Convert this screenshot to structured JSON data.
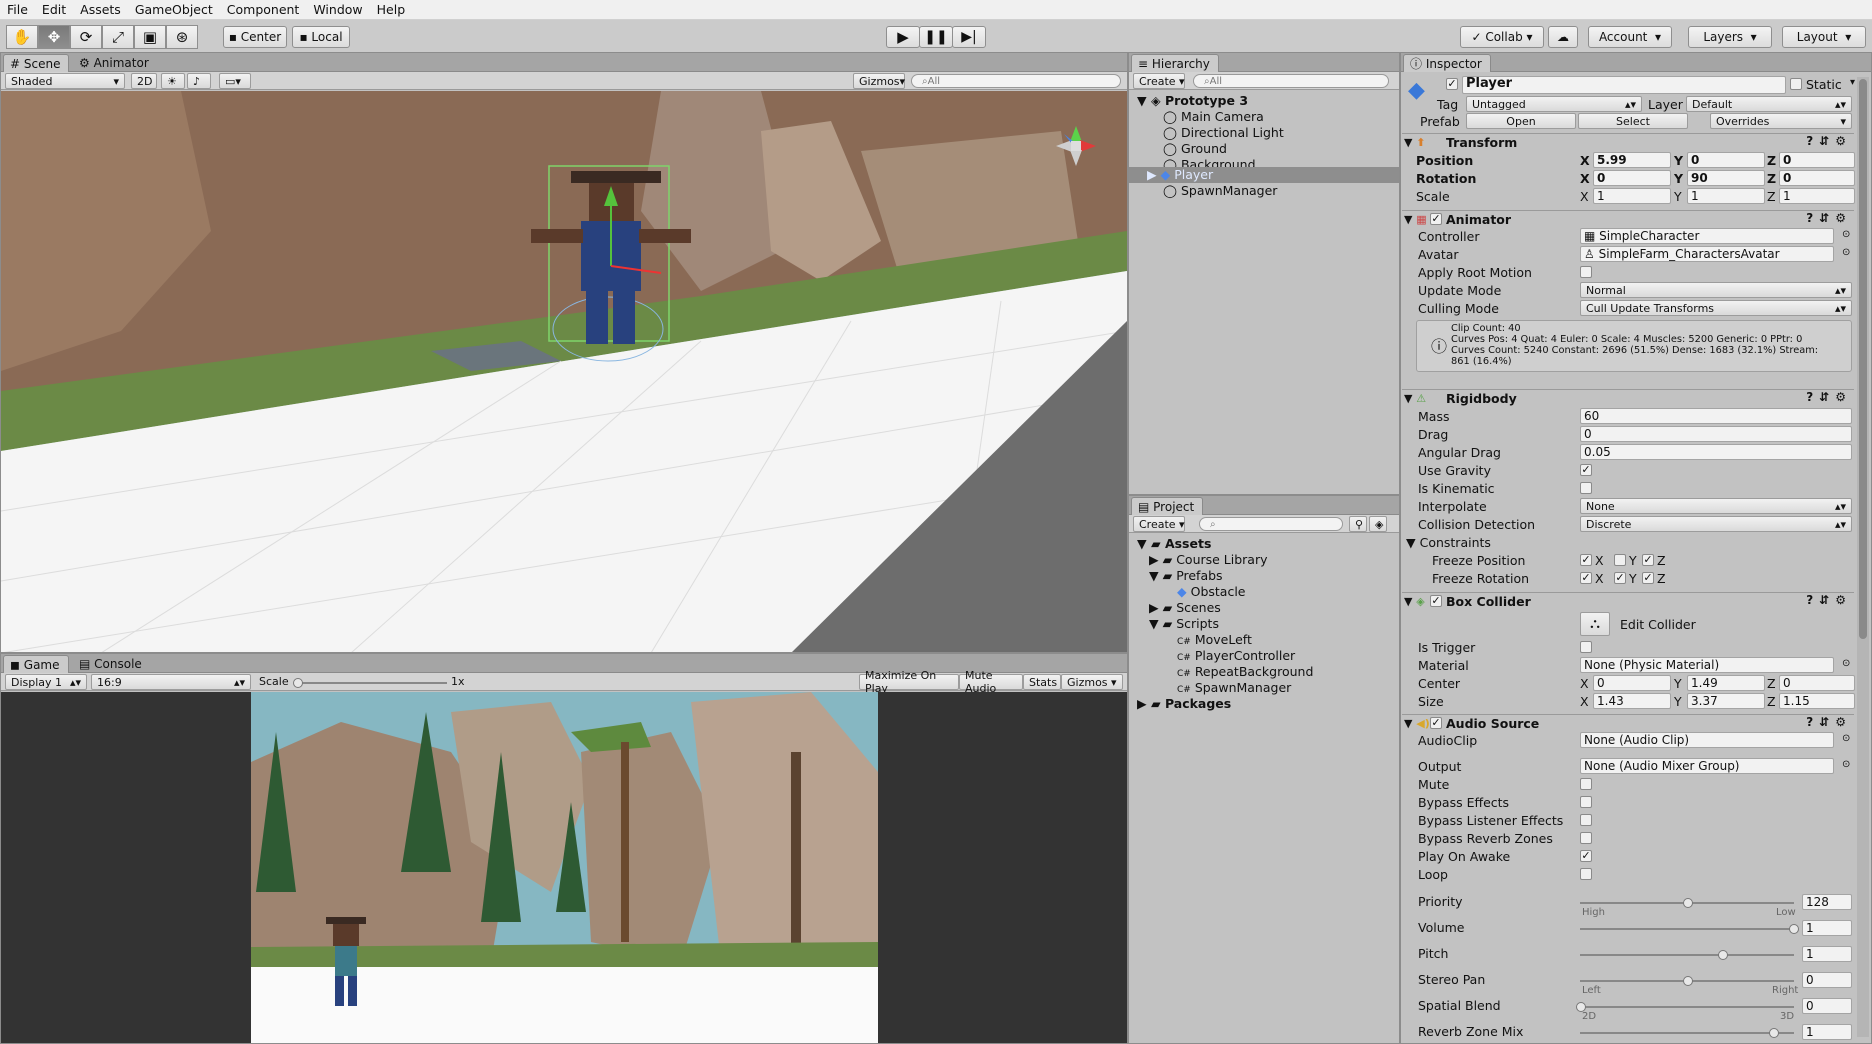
{
  "menu": [
    "File",
    "Edit",
    "Assets",
    "GameObject",
    "Component",
    "Window",
    "Help"
  ],
  "toolbar": {
    "center": "Center",
    "local": "Local",
    "collab": "Collab",
    "account": "Account",
    "layers": "Layers",
    "layout": "Layout"
  },
  "scene": {
    "tab_scene": "Scene",
    "tab_animator": "Animator",
    "shading": "Shaded",
    "mode2d": "2D",
    "gizmos": "Gizmos",
    "search": "All"
  },
  "game": {
    "tab_game": "Game",
    "tab_console": "Console",
    "display": "Display 1",
    "aspect": "16:9",
    "scale_label": "Scale",
    "scale_value": "1x",
    "maximize": "Maximize On Play",
    "mute": "Mute Audio",
    "stats": "Stats",
    "gizmos": "Gizmos"
  },
  "hierarchy": {
    "tab": "Hierarchy",
    "create": "Create",
    "search": "All",
    "scene": "Prototype 3",
    "items": [
      "Main Camera",
      "Directional Light",
      "Ground",
      "Background",
      "Player",
      "SpawnManager"
    ]
  },
  "project": {
    "tab": "Project",
    "create": "Create",
    "assets": "Assets",
    "items": [
      "Course Library",
      "Prefabs",
      "Obstacle",
      "Scenes",
      "Scripts",
      "MoveLeft",
      "PlayerController",
      "RepeatBackground",
      "SpawnManager"
    ],
    "packages": "Packages"
  },
  "inspector": {
    "tab": "Inspector",
    "name": "Player",
    "static": "Static",
    "tag_label": "Tag",
    "tag": "Untagged",
    "layer_label": "Layer",
    "layer": "Default",
    "prefab_label": "Prefab",
    "open": "Open",
    "select": "Select",
    "overrides": "Overrides",
    "transform": {
      "title": "Transform",
      "position": "Position",
      "rotation": "Rotation",
      "scale": "Scale",
      "pos": [
        "5.99",
        "0",
        "0"
      ],
      "rot": [
        "0",
        "90",
        "0"
      ],
      "scl": [
        "1",
        "1",
        "1"
      ]
    },
    "animator": {
      "title": "Animator",
      "controller_label": "Controller",
      "controller": "SimpleCharacter",
      "avatar_label": "Avatar",
      "avatar": "SimpleFarm_CharactersAvatar",
      "apply_root": "Apply Root Motion",
      "update_label": "Update Mode",
      "update": "Normal",
      "culling_label": "Culling Mode",
      "culling": "Cull Update Transforms",
      "info": [
        "Clip Count: 40",
        "Curves Pos: 4 Quat: 4 Euler: 0 Scale: 4 Muscles: 5200 Generic: 0 PPtr: 0",
        "Curves Count: 5240 Constant: 2696 (51.5%) Dense: 1683 (32.1%) Stream:",
        "861 (16.4%)"
      ]
    },
    "rigidbody": {
      "title": "Rigidbody",
      "mass_label": "Mass",
      "mass": "60",
      "drag_label": "Drag",
      "drag": "0",
      "angular_label": "Angular Drag",
      "angular": "0.05",
      "gravity": "Use Gravity",
      "kinematic": "Is Kinematic",
      "interp_label": "Interpolate",
      "interp": "None",
      "collision_label": "Collision Detection",
      "collision": "Discrete",
      "constraints": "Constraints",
      "freeze_pos": "Freeze Position",
      "freeze_rot": "Freeze Rotation"
    },
    "box": {
      "title": "Box Collider",
      "edit": "Edit Collider",
      "trigger": "Is Trigger",
      "material_label": "Material",
      "material": "None (Physic Material)",
      "center_label": "Center",
      "center": [
        "0",
        "1.49",
        "0"
      ],
      "size_label": "Size",
      "size": [
        "1.43",
        "3.37",
        "1.15"
      ]
    },
    "audio": {
      "title": "Audio Source",
      "clip_label": "AudioClip",
      "clip": "None (Audio Clip)",
      "output_label": "Output",
      "output": "None (Audio Mixer Group)",
      "mute": "Mute",
      "bypass": "Bypass Effects",
      "bypass_listener": "Bypass Listener Effects",
      "bypass_reverb": "Bypass Reverb Zones",
      "play": "Play On Awake",
      "loop": "Loop",
      "priority_label": "Priority",
      "priority": "128",
      "high": "High",
      "low": "Low",
      "volume_label": "Volume",
      "volume": "1",
      "pitch_label": "Pitch",
      "pitch": "1",
      "pan_label": "Stereo Pan",
      "pan": "0",
      "left": "Left",
      "right": "Right",
      "spatial_label": "Spatial Blend",
      "spatial": "0",
      "s2d": "2D",
      "s3d": "3D",
      "reverb_label": "Reverb Zone Mix",
      "reverb": "1"
    }
  }
}
